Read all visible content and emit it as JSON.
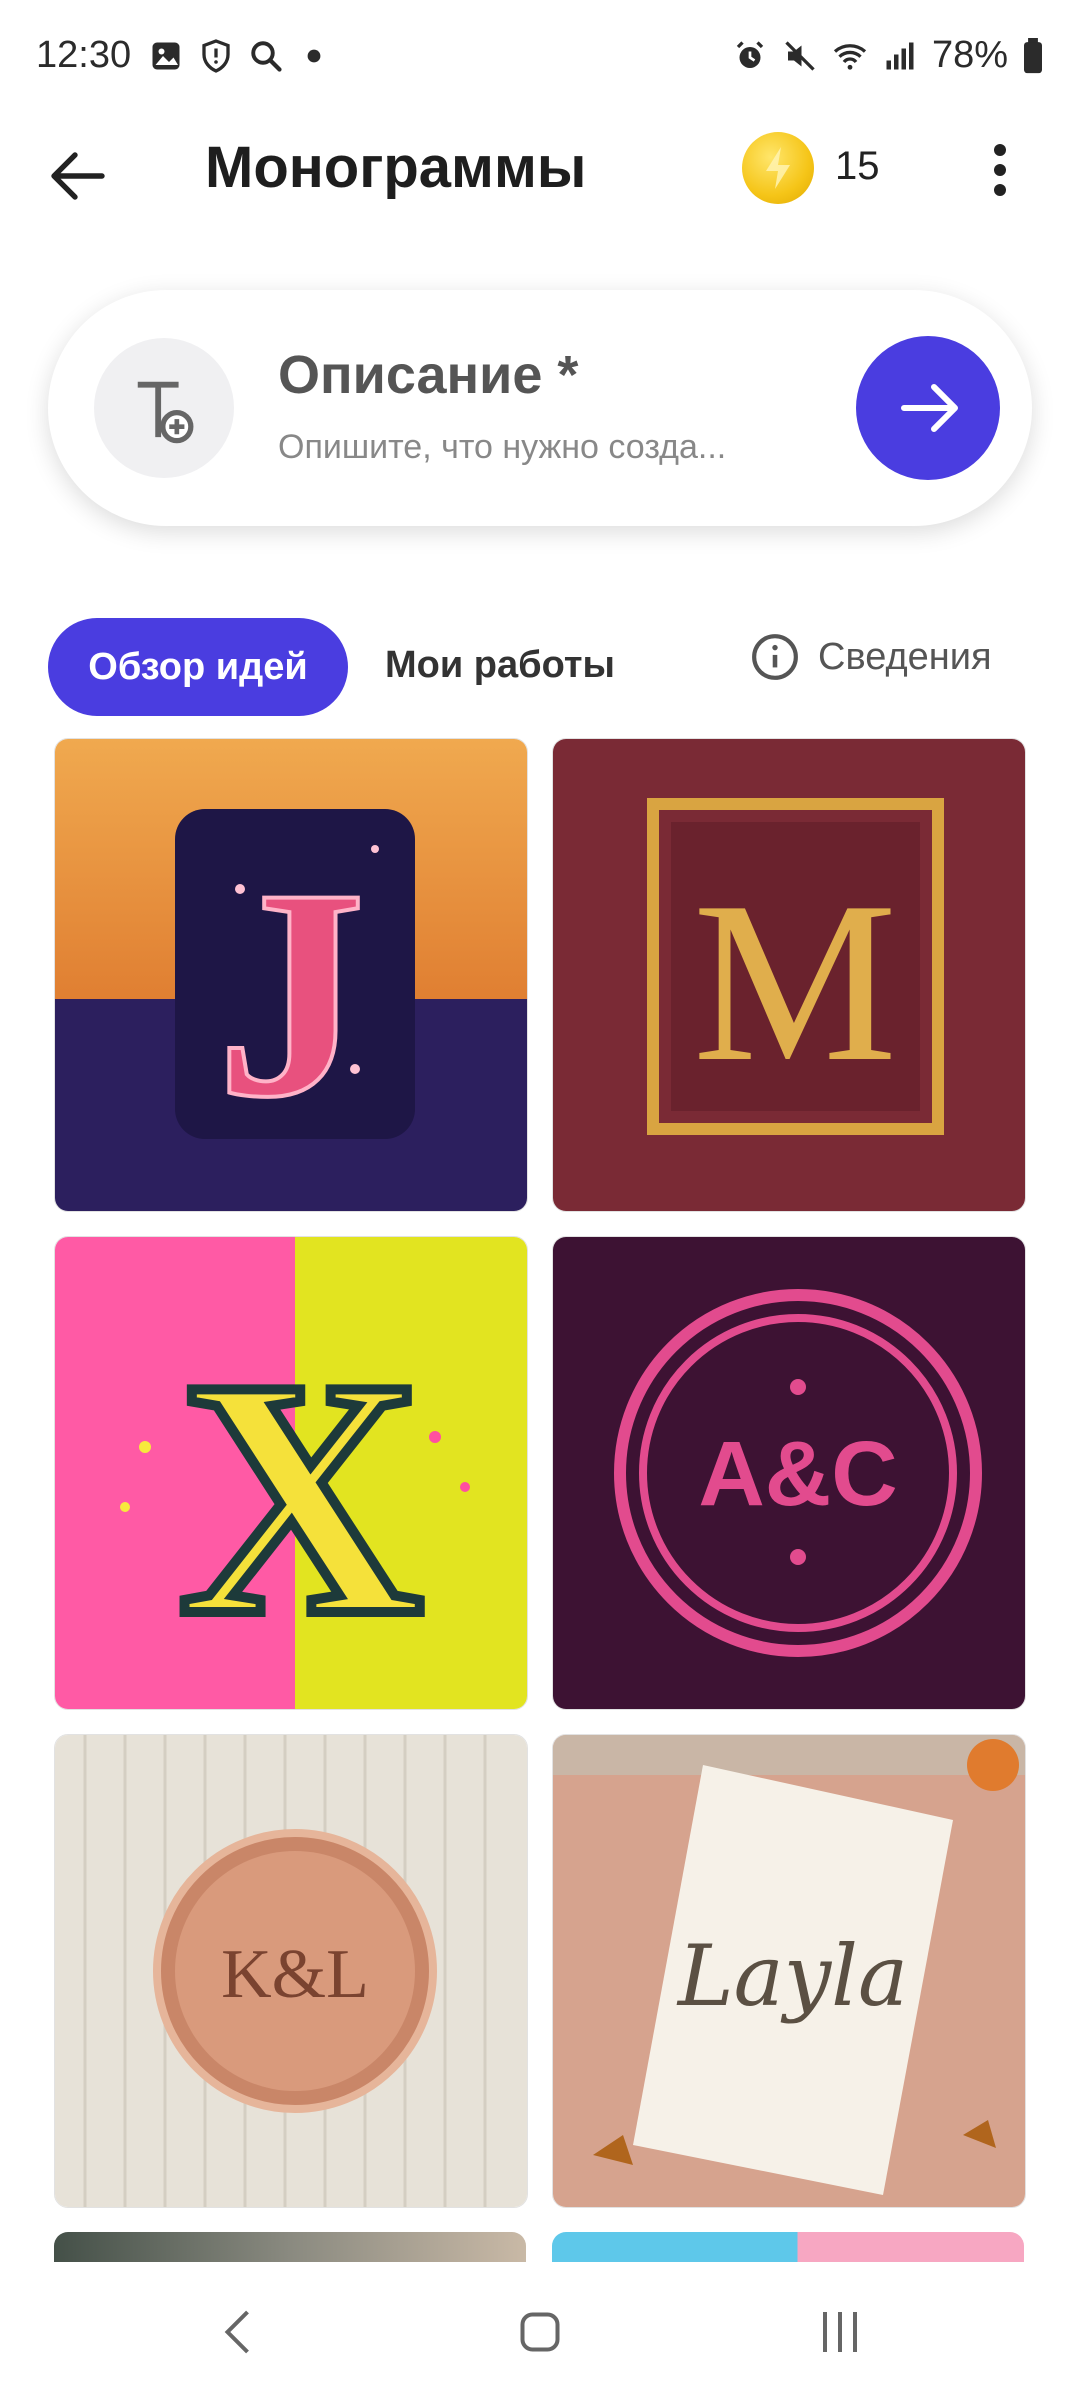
{
  "status_bar": {
    "time": "12:30",
    "battery": "78%"
  },
  "header": {
    "title": "Монограммы",
    "coins": "15"
  },
  "prompt": {
    "label": "Описание *",
    "placeholder": "Опишите, что нужно созда..."
  },
  "tabs": {
    "ideas": "Обзор идей",
    "my_works": "Мои работы",
    "info": "Сведения"
  },
  "ideas": [
    {
      "name": "J",
      "text": "J"
    },
    {
      "name": "M",
      "text": "M"
    },
    {
      "name": "X",
      "text": "X"
    },
    {
      "name": "A&C",
      "text": "A&C"
    },
    {
      "name": "K&L",
      "text": "K&L"
    },
    {
      "name": "Layla",
      "text": "Layla"
    }
  ],
  "colors": {
    "accent": "#4a3de0",
    "coin": "#f5c518"
  }
}
